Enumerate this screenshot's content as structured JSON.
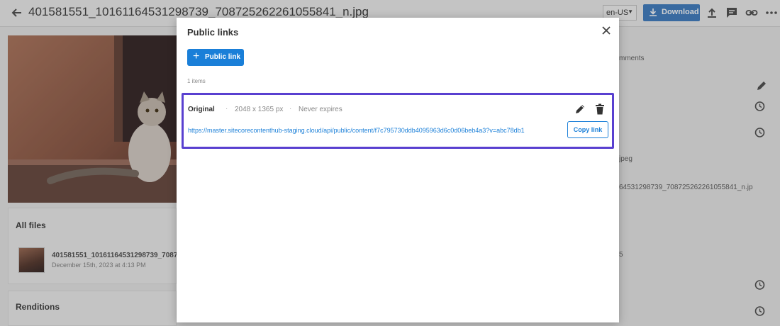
{
  "app": {
    "file_title": "401581551_10161164531298739_708725262261055841_n.jpg",
    "language": "en-US",
    "download_label": "Download",
    "all_files_label": "All files",
    "file_name": "401581551_10161164531298739_7087",
    "file_date": "December 15th, 2023 at 4:13 PM",
    "renditions_label": "Renditions",
    "right_tab_fragment": "mments",
    "right_ext_fragment": "jpeg",
    "right_filename_fragment": "64531298739_708725262261055841_n.jp",
    "right_number_fragment": "5"
  },
  "modal": {
    "title": "Public links",
    "add_button_label": "Public link",
    "items_count": "1 items",
    "link": {
      "name": "Original",
      "dimensions": "2048 x 1365 px",
      "expiry": "Never expires",
      "url": "https://master.sitecorecontenthub-staging.cloud/api/public/content/f7c795730ddb4095963d6c0d06beb4a3?v=abc78db1",
      "copy_label": "Copy link"
    }
  },
  "colors": {
    "accent": "#1a7fd8",
    "highlight_border": "#5940d0",
    "download_button": "#4682c4"
  }
}
